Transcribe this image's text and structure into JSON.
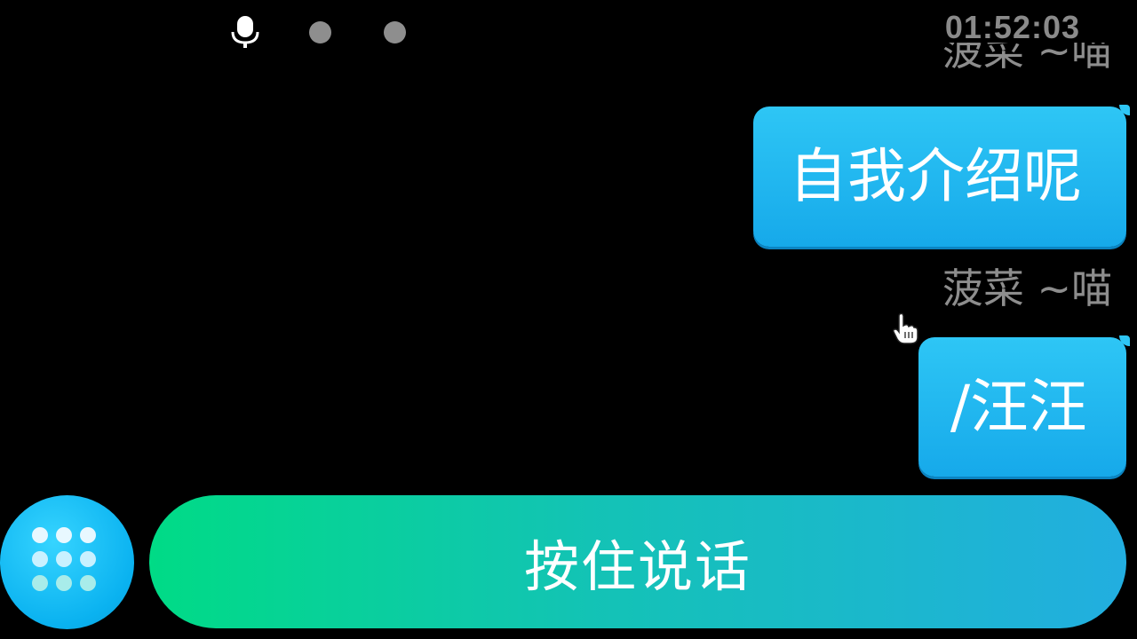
{
  "status_bar": {
    "clock": "01:52:03",
    "icons": [
      "microphone-icon",
      "indicator-dot",
      "indicator-dot"
    ]
  },
  "chat": {
    "messages": [
      {
        "sender": "菠菜 ~喵",
        "text": "自我介绍呢"
      },
      {
        "sender": "菠菜 ~喵",
        "text": "/汪汪"
      }
    ]
  },
  "controls": {
    "menu_icon": "grid-dots-icon",
    "talk_label": "按住说话"
  },
  "colors": {
    "background": "#000000",
    "bubble": "#1fb6ee",
    "talk_gradient_start": "#00db86",
    "talk_gradient_end": "#22aee0",
    "sender_text": "#8d8d8d",
    "clock_text": "#8a8a8a"
  }
}
